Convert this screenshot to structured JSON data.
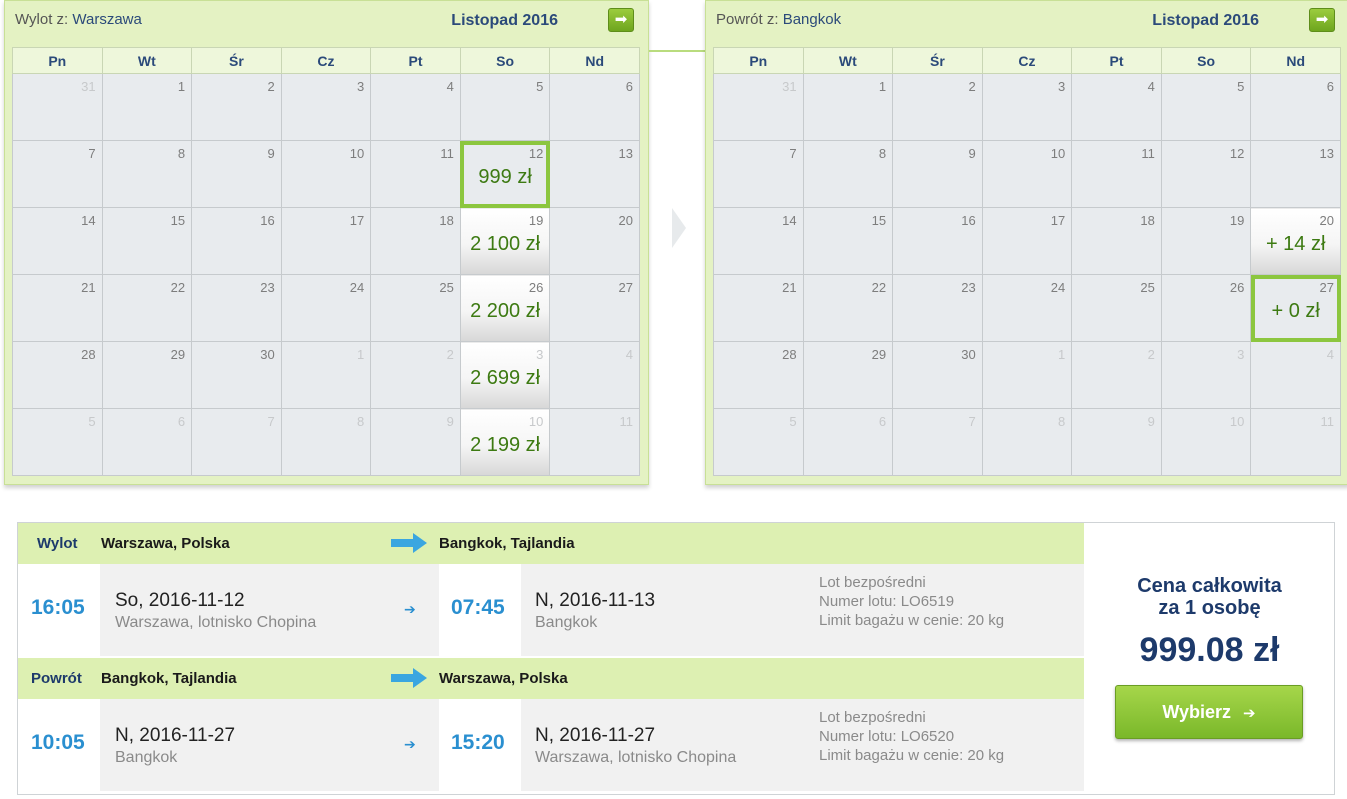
{
  "outbound_calendar": {
    "route_prefix": "Wylot z:",
    "route_city": "Warszawa",
    "month": "Listopad 2016",
    "next_icon": "arrow-right-icon",
    "weekdays": [
      "Pn",
      "Wt",
      "Śr",
      "Cz",
      "Pt",
      "So",
      "Nd"
    ],
    "weeks": [
      [
        {
          "d": "31",
          "o": true
        },
        {
          "d": "1"
        },
        {
          "d": "2"
        },
        {
          "d": "3"
        },
        {
          "d": "4"
        },
        {
          "d": "5"
        },
        {
          "d": "6"
        }
      ],
      [
        {
          "d": "7"
        },
        {
          "d": "8"
        },
        {
          "d": "9"
        },
        {
          "d": "10"
        },
        {
          "d": "11"
        },
        {
          "d": "12",
          "p": "999 zł",
          "s": true
        },
        {
          "d": "13"
        }
      ],
      [
        {
          "d": "14"
        },
        {
          "d": "15"
        },
        {
          "d": "16"
        },
        {
          "d": "17"
        },
        {
          "d": "18"
        },
        {
          "d": "19",
          "p": "2 100 zł"
        },
        {
          "d": "20"
        }
      ],
      [
        {
          "d": "21"
        },
        {
          "d": "22"
        },
        {
          "d": "23"
        },
        {
          "d": "24"
        },
        {
          "d": "25"
        },
        {
          "d": "26",
          "p": "2 200 zł"
        },
        {
          "d": "27"
        }
      ],
      [
        {
          "d": "28"
        },
        {
          "d": "29"
        },
        {
          "d": "30"
        },
        {
          "d": "1",
          "o": true
        },
        {
          "d": "2",
          "o": true
        },
        {
          "d": "3",
          "o": true,
          "p": "2 699 zł"
        },
        {
          "d": "4",
          "o": true
        }
      ],
      [
        {
          "d": "5",
          "o": true
        },
        {
          "d": "6",
          "o": true
        },
        {
          "d": "7",
          "o": true
        },
        {
          "d": "8",
          "o": true
        },
        {
          "d": "9",
          "o": true
        },
        {
          "d": "10",
          "o": true,
          "p": "2 199 zł"
        },
        {
          "d": "11",
          "o": true
        }
      ]
    ]
  },
  "return_calendar": {
    "route_prefix": "Powrót z:",
    "route_city": "Bangkok",
    "month": "Listopad 2016",
    "next_icon": "arrow-right-icon",
    "weekdays": [
      "Pn",
      "Wt",
      "Śr",
      "Cz",
      "Pt",
      "So",
      "Nd"
    ],
    "weeks": [
      [
        {
          "d": "31",
          "o": true
        },
        {
          "d": "1"
        },
        {
          "d": "2"
        },
        {
          "d": "3"
        },
        {
          "d": "4"
        },
        {
          "d": "5"
        },
        {
          "d": "6"
        }
      ],
      [
        {
          "d": "7"
        },
        {
          "d": "8"
        },
        {
          "d": "9"
        },
        {
          "d": "10"
        },
        {
          "d": "11"
        },
        {
          "d": "12"
        },
        {
          "d": "13"
        }
      ],
      [
        {
          "d": "14"
        },
        {
          "d": "15"
        },
        {
          "d": "16"
        },
        {
          "d": "17"
        },
        {
          "d": "18"
        },
        {
          "d": "19"
        },
        {
          "d": "20",
          "p": "+ 14 zł"
        }
      ],
      [
        {
          "d": "21"
        },
        {
          "d": "22"
        },
        {
          "d": "23"
        },
        {
          "d": "24"
        },
        {
          "d": "25"
        },
        {
          "d": "26"
        },
        {
          "d": "27",
          "p": "+ 0 zł",
          "s": true
        }
      ],
      [
        {
          "d": "28"
        },
        {
          "d": "29"
        },
        {
          "d": "30"
        },
        {
          "d": "1",
          "o": true
        },
        {
          "d": "2",
          "o": true
        },
        {
          "d": "3",
          "o": true
        },
        {
          "d": "4",
          "o": true
        }
      ],
      [
        {
          "d": "5",
          "o": true
        },
        {
          "d": "6",
          "o": true
        },
        {
          "d": "7",
          "o": true
        },
        {
          "d": "8",
          "o": true
        },
        {
          "d": "9",
          "o": true
        },
        {
          "d": "10",
          "o": true
        },
        {
          "d": "11",
          "o": true
        }
      ]
    ]
  },
  "summary": {
    "outbound": {
      "label": "Wylot",
      "from": "Warszawa, Polska",
      "to": "Bangkok, Tajlandia",
      "dep_time": "16:05",
      "dep_date": "So, 2016-11-12",
      "dep_place": "Warszawa, lotnisko Chopina",
      "arr_time": "07:45",
      "arr_date": "N, 2016-11-13",
      "arr_place": "Bangkok",
      "flight_type": "Lot bezpośredni",
      "flight_number": "Numer lotu: LO6519",
      "baggage": "Limit bagażu w cenie: 20 kg"
    },
    "return": {
      "label": "Powrót",
      "from": "Bangkok, Tajlandia",
      "to": "Warszawa, Polska",
      "dep_time": "10:05",
      "dep_date": "N, 2016-11-27",
      "dep_place": "Bangkok",
      "arr_time": "15:20",
      "arr_date": "N, 2016-11-27",
      "arr_place": "Warszawa, lotnisko Chopina",
      "flight_type": "Lot bezpośredni",
      "flight_number": "Numer lotu: LO6520",
      "baggage": "Limit bagażu w cenie: 20 kg"
    },
    "total_label_line1": "Cena całkowita",
    "total_label_line2": "za 1 osobę",
    "total_price": "999.08 zł",
    "choose_button": "Wybierz",
    "choose_icon": "arrow-right-icon"
  },
  "colors": {
    "accent_green": "#8cc63f",
    "price_green": "#3d7a12",
    "time_blue": "#2a8fd0",
    "navy": "#1d3a6b",
    "bar_green": "#ddf0b2"
  }
}
